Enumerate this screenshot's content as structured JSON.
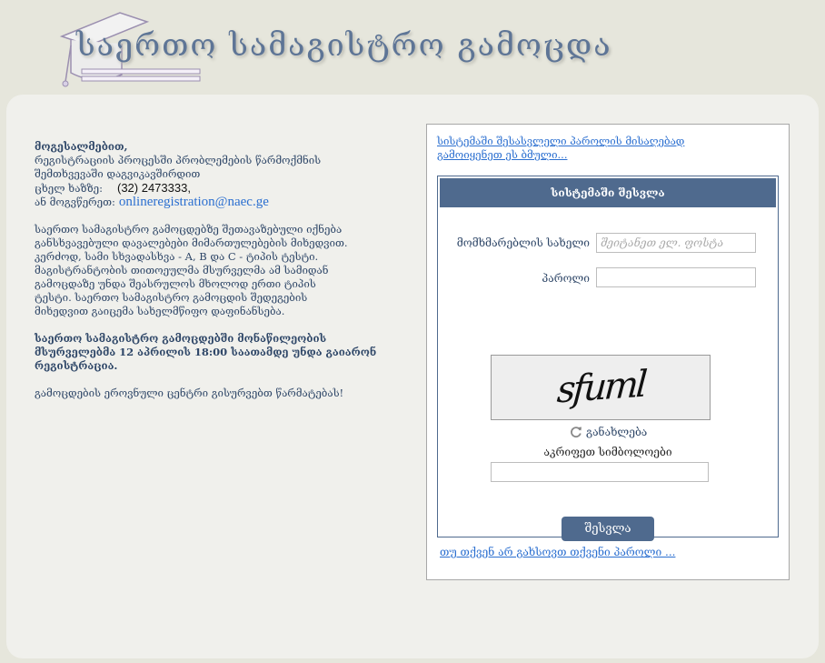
{
  "header": {
    "title": "საერთო სამაგისტრო გამოცდა"
  },
  "info": {
    "greeting": "მოგესალმებით,",
    "problem_line1": "რეგისტრაციის პროცესში პრობლემების წარმოქმნის",
    "problem_line2": "შემთხვევაში დაგვიკავშირდით",
    "phone_label": "ცხელ ხაზზე:",
    "phone_number": "(32) 2473333,",
    "email_label": "ან მოგვწერეთ:",
    "email": "onlineregistration@naec.ge",
    "exams_line1": "საერთო სამაგისტრო გამოცდებზე შეთავაზებული იქნება",
    "exams_line2": "განსხვავებული დავალებები მიმართულებების მიხედვით.",
    "exams_line3": "კერძოდ, სამი სხვადასხვა - A, B და C - ტიპის ტესტი.",
    "exams_line4": "მაგისტრანტობის თითოეულმა მსურველმა ამ სამიდან",
    "exams_line5": "გამოცდაზე უნდა შეასრულოს მხოლოდ ერთი ტიპის",
    "exams_line6": "ტესტი. საერთო სამაგისტრო გამოცდის შედეგების",
    "exams_line7": "მიხედვით გაიცემა სახელმწიფო დაფინანსება.",
    "deadline_line1": "საერთო სამაგისტრო გამოცდებში მონაწილეობის",
    "deadline_line2": "მსურველებმა 12 აპრილის 18:00 საათამდე უნდა გაიარონ",
    "deadline_line3": "რეგისტრაცია.",
    "wishes": "გამოცდების ეროვნული ცენტრი გისურვებთ წარმატებას!"
  },
  "login": {
    "password_help_link": "სისტემაში შესასვლელი პაროლის მისაღებად გამოიყენეთ ეს ბმული...",
    "header": "სისტემაში შესვლა",
    "username_label": "მომხმარებლის სახელი",
    "username_placeholder": "შეიტანეთ ელ. ფოსტა",
    "username_value": "",
    "password_label": "პაროლი",
    "password_value": "",
    "captcha_text": "sfuml",
    "refresh_label": "განახლება",
    "captcha_prompt": "აკრიფეთ სიმბოლოები",
    "captcha_value": "",
    "submit_label": "შესვლა",
    "forgot_link": "თუ თქვენ არ გახსოვთ თქვენი პაროლი ..."
  },
  "colors": {
    "accent": "#4f6a8e",
    "link": "#2b6fd0",
    "title": "#5e7596",
    "background": "#e6e6dc",
    "panel": "#f0f0ec"
  },
  "icons": {
    "logo": "graduation-cap-icon",
    "refresh": "refresh-icon"
  }
}
